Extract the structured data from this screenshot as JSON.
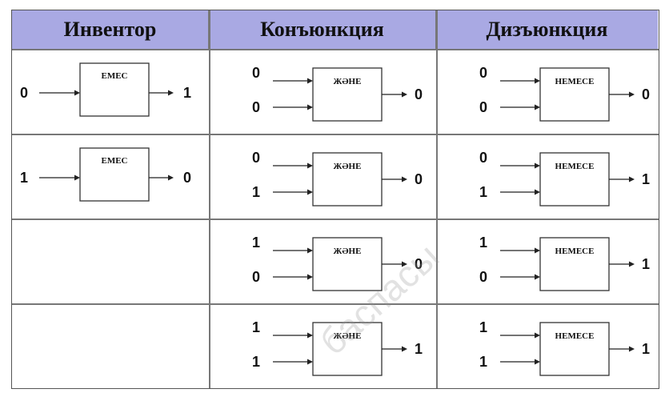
{
  "headers": [
    "Инвентор",
    "Конъюнкция",
    "Дизъюнкция"
  ],
  "gate_labels": {
    "not": "ЕМЕС",
    "and": "ЖӘНЕ",
    "or": "НЕМЕСЕ"
  },
  "not_rows": [
    {
      "input": "0",
      "output": "1"
    },
    {
      "input": "1",
      "output": "0"
    }
  ],
  "and_rows": [
    {
      "a": "0",
      "b": "0",
      "output": "0"
    },
    {
      "a": "0",
      "b": "1",
      "output": "0"
    },
    {
      "a": "1",
      "b": "0",
      "output": "0"
    },
    {
      "a": "1",
      "b": "1",
      "output": "1"
    }
  ],
  "or_rows": [
    {
      "a": "0",
      "b": "0",
      "output": "0"
    },
    {
      "a": "0",
      "b": "1",
      "output": "1"
    },
    {
      "a": "1",
      "b": "0",
      "output": "1"
    },
    {
      "a": "1",
      "b": "1",
      "output": "1"
    }
  ],
  "watermark": "баспасы",
  "colors": {
    "header_bg": "#a9a9e3",
    "border": "#777777"
  }
}
